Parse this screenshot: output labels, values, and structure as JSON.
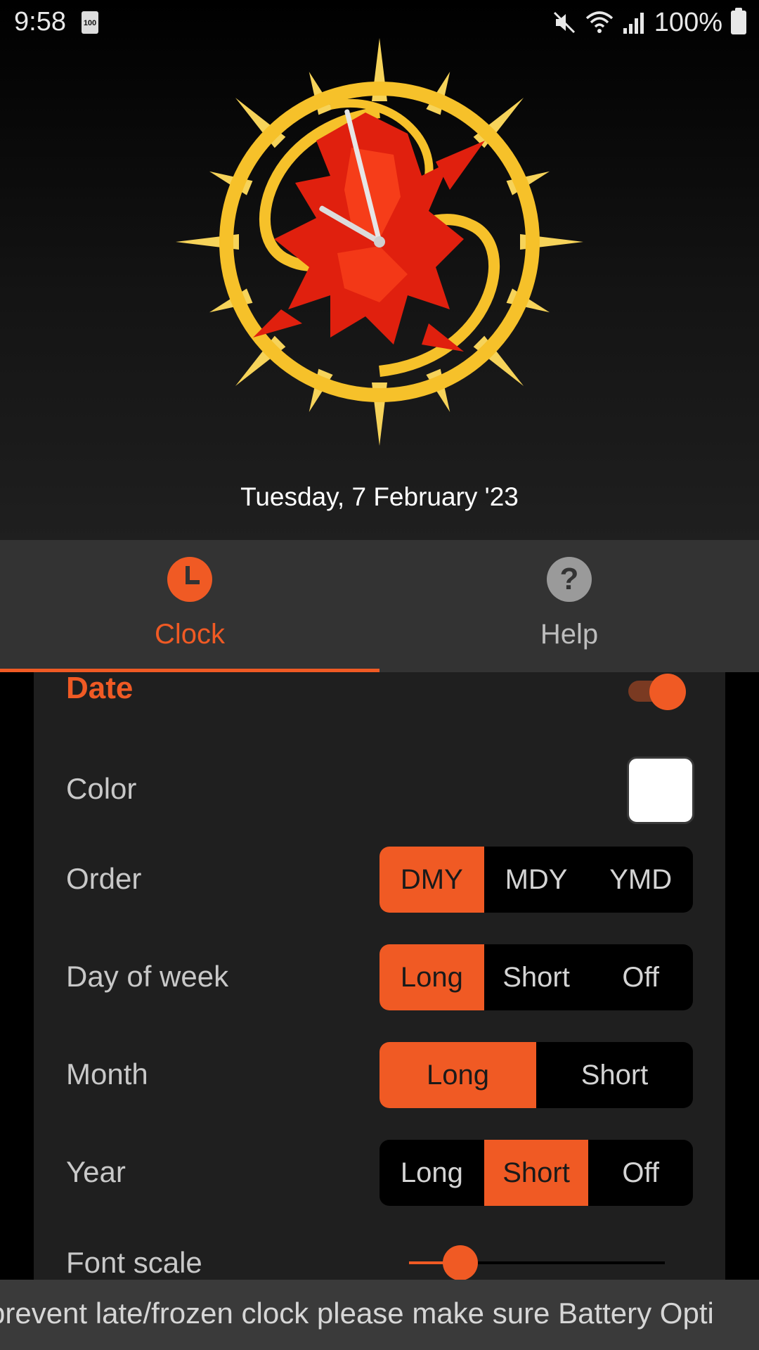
{
  "status_bar": {
    "time": "9:58",
    "battery_small": "100",
    "battery_percent": "100%"
  },
  "header": {
    "date_text": "Tuesday, 7 February '23",
    "clock_hour_hand_angle_deg": -60,
    "clock_minute_hand_angle_deg": -14
  },
  "tabs": [
    {
      "label": "Clock",
      "icon": "clock-icon",
      "selected": true
    },
    {
      "label": "Help",
      "icon": "help-icon",
      "icon_glyph": "?",
      "selected": false
    }
  ],
  "settings": {
    "section_title": "Date",
    "enabled": true,
    "color_label": "Color",
    "color_value": "#ffffff",
    "order": {
      "label": "Order",
      "options": [
        "DMY",
        "MDY",
        "YMD"
      ],
      "selected": "DMY"
    },
    "day_of_week": {
      "label": "Day of week",
      "options": [
        "Long",
        "Short",
        "Off"
      ],
      "selected": "Long"
    },
    "month": {
      "label": "Month",
      "options": [
        "Long",
        "Short"
      ],
      "selected": "Long"
    },
    "year": {
      "label": "Year",
      "options": [
        "Long",
        "Short",
        "Off"
      ],
      "selected": "Short"
    },
    "font_scale": {
      "label": "Font scale",
      "value_fraction": 0.2
    }
  },
  "ticker_text": "prevent late/frozen clock please make sure Battery Opti",
  "colors": {
    "accent": "#f05a24",
    "gold": "#f6c12a",
    "red": "#e0200e"
  }
}
